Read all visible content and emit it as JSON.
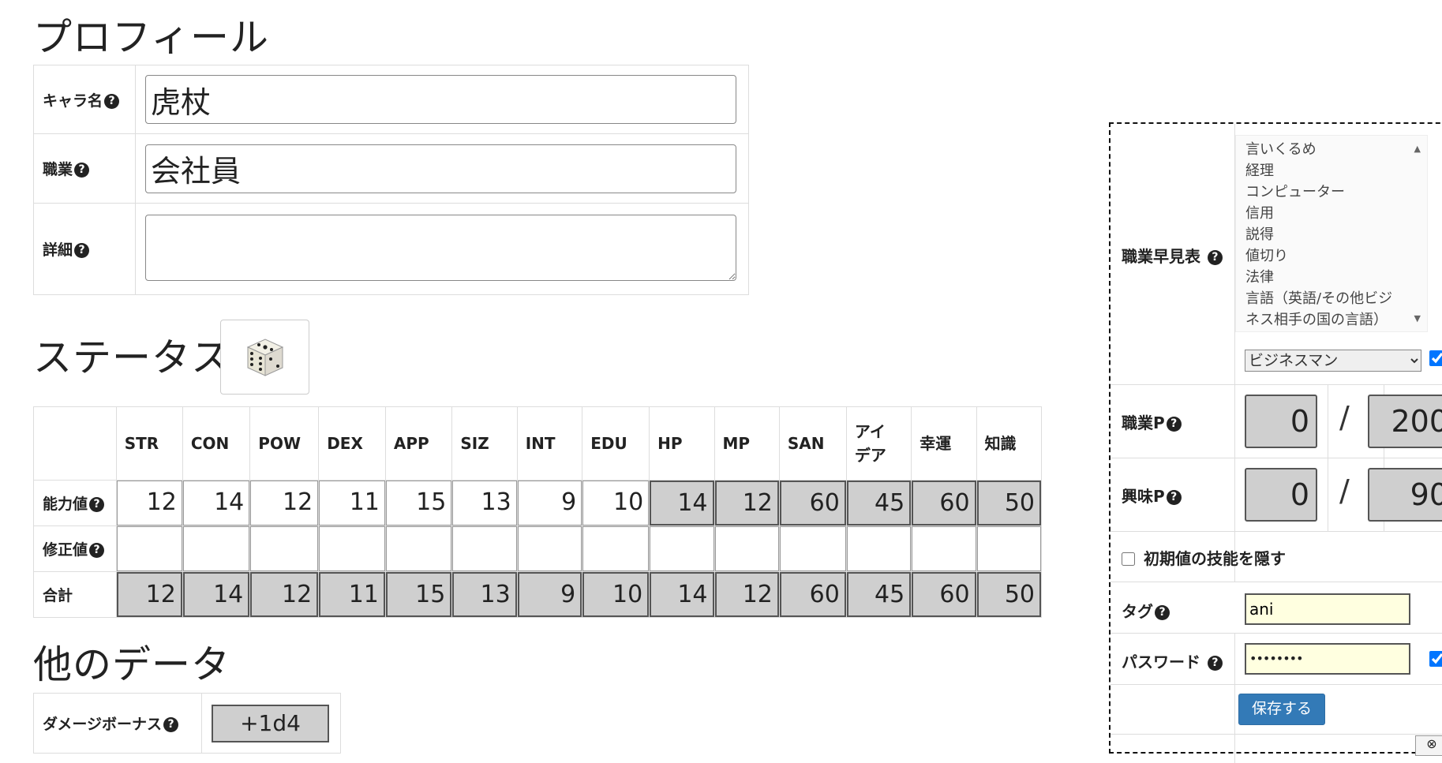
{
  "profile": {
    "heading": "プロフィール",
    "name_label": "キャラ名",
    "name_value": "虎杖",
    "job_label": "職業",
    "job_value": "会社員",
    "detail_label": "詳細",
    "detail_value": ""
  },
  "status": {
    "heading": "ステータス",
    "dice_icon": "dice-icon",
    "columns": [
      "STR",
      "CON",
      "POW",
      "DEX",
      "APP",
      "SIZ",
      "INT",
      "EDU",
      "HP",
      "MP",
      "SAN",
      "アイ\nデア",
      "幸運",
      "知識"
    ],
    "row_labels": {
      "base": "能力値",
      "mod": "修正値",
      "total": "合計"
    },
    "base": [
      "12",
      "14",
      "12",
      "11",
      "15",
      "13",
      "9",
      "10",
      "14",
      "12",
      "60",
      "45",
      "60",
      "50"
    ],
    "mod": [
      "",
      "",
      "",
      "",
      "",
      "",
      "",
      "",
      "",
      "",
      "",
      "",
      "",
      ""
    ],
    "total": [
      "12",
      "14",
      "12",
      "11",
      "15",
      "13",
      "9",
      "10",
      "14",
      "12",
      "60",
      "45",
      "60",
      "50"
    ]
  },
  "other": {
    "heading": "他のデータ",
    "damage_label": "ダメージボーナス",
    "damage_value": "+1d4"
  },
  "panel": {
    "job_skills_label": "職業早見表",
    "job_skills": [
      "言いくるめ",
      "経理",
      "コンピューター",
      "信用",
      "説得",
      "値切り",
      "法律",
      "言語（英語/その他ビジ",
      "ネス相手の国の言語）"
    ],
    "job_select": "ビジネスマン",
    "job_points_label": "職業P",
    "job_points_used": "0",
    "job_points_total": "200",
    "interest_points_label": "興味P",
    "interest_points_used": "0",
    "interest_points_total": "90",
    "slash": "/",
    "hide_default_label": "初期値の技能を隠す",
    "tag_label": "タグ",
    "tag_value": "ani",
    "password_label": "パスワード",
    "password_value": "••••••••",
    "save_label": "保存する"
  }
}
